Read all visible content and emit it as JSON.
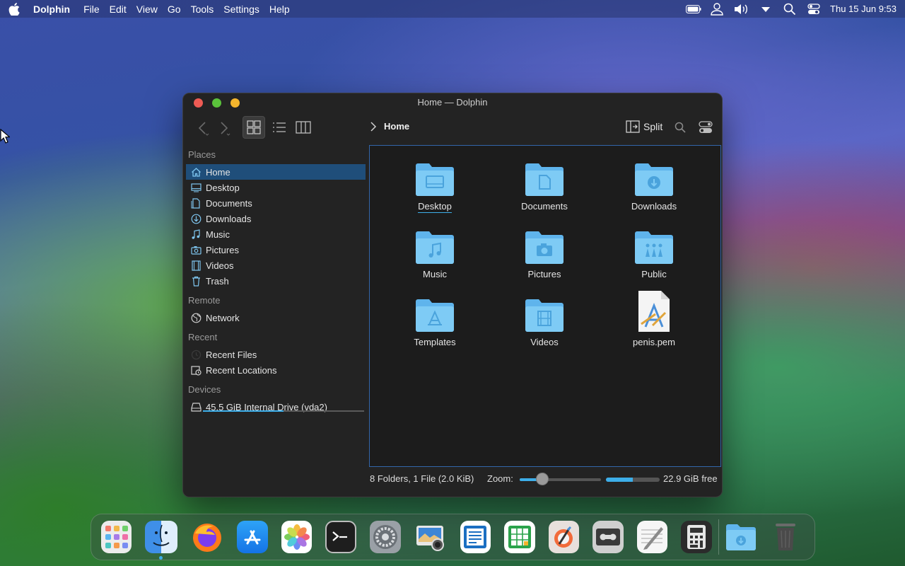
{
  "menubar": {
    "app_name": "Dolphin",
    "items": [
      "File",
      "Edit",
      "View",
      "Go",
      "Tools",
      "Settings",
      "Help"
    ],
    "clock": "Thu 15 Jun 9:53"
  },
  "window": {
    "title": "Home — Dolphin",
    "breadcrumb": "Home",
    "split_label": "Split"
  },
  "sidebar": {
    "places_header": "Places",
    "places": [
      {
        "label": "Home",
        "icon": "home-icon"
      },
      {
        "label": "Desktop",
        "icon": "desktop-icon"
      },
      {
        "label": "Documents",
        "icon": "documents-icon"
      },
      {
        "label": "Downloads",
        "icon": "downloads-icon"
      },
      {
        "label": "Music",
        "icon": "music-icon"
      },
      {
        "label": "Pictures",
        "icon": "pictures-icon"
      },
      {
        "label": "Videos",
        "icon": "videos-icon"
      },
      {
        "label": "Trash",
        "icon": "trash-icon"
      }
    ],
    "remote_header": "Remote",
    "remote": [
      {
        "label": "Network",
        "icon": "network-icon"
      }
    ],
    "recent_header": "Recent",
    "recent": [
      {
        "label": "Recent Files",
        "icon": "recent-files-icon"
      },
      {
        "label": "Recent Locations",
        "icon": "recent-locations-icon"
      }
    ],
    "devices_header": "Devices",
    "devices": [
      {
        "label": "45.5 GiB Internal Drive (vda2)",
        "icon": "drive-icon",
        "used_fraction": 0.5
      }
    ]
  },
  "content": {
    "items": [
      {
        "label": "Desktop",
        "kind": "folder",
        "icon": "folder-desktop-icon"
      },
      {
        "label": "Documents",
        "kind": "folder",
        "icon": "folder-documents-icon"
      },
      {
        "label": "Downloads",
        "kind": "folder",
        "icon": "folder-downloads-icon"
      },
      {
        "label": "Music",
        "kind": "folder",
        "icon": "folder-music-icon"
      },
      {
        "label": "Pictures",
        "kind": "folder",
        "icon": "folder-pictures-icon"
      },
      {
        "label": "Public",
        "kind": "folder",
        "icon": "folder-public-icon"
      },
      {
        "label": "Templates",
        "kind": "folder",
        "icon": "folder-templates-icon"
      },
      {
        "label": "Videos",
        "kind": "folder",
        "icon": "folder-videos-icon"
      },
      {
        "label": "penis.pem",
        "kind": "file",
        "icon": "certificate-file-icon"
      }
    ]
  },
  "statusbar": {
    "summary": "8 Folders, 1 File (2.0 KiB)",
    "zoom_label": "Zoom:",
    "zoom_fraction": 0.28,
    "free_space": "22.9 GiB free",
    "used_fraction": 0.5
  },
  "dock": {
    "apps": [
      "launcher-icon",
      "finder-icon",
      "firefox-icon",
      "app-store-icon",
      "photos-icon",
      "terminal-icon",
      "system-settings-icon",
      "screenshot-icon",
      "writer-icon",
      "calc-icon",
      "krita-icon",
      "tape-recorder-icon",
      "text-editor-icon",
      "calculator-icon",
      "downloads-stack-icon",
      "trash-dock-icon"
    ]
  },
  "colors": {
    "accent": "#3daee9",
    "selection": "#1f4e7a",
    "folder": "#6ec1f2",
    "window_bg": "#232323",
    "content_bg": "#1c1c1c"
  }
}
